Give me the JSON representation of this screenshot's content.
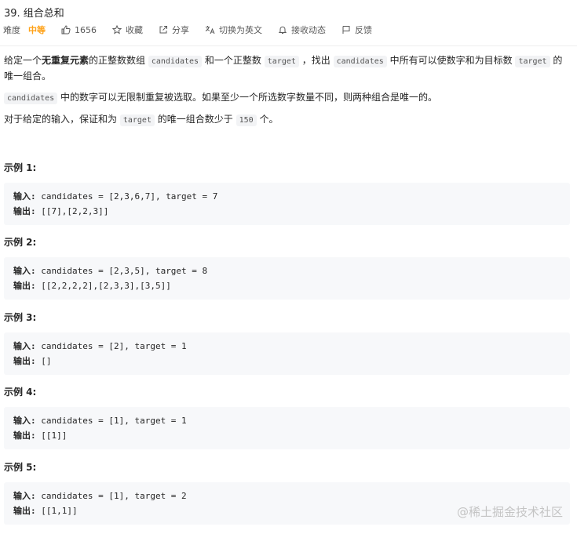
{
  "problem": {
    "title": "39. 组合总和",
    "difficulty_label": "难度",
    "difficulty_value": "中等",
    "likes": "1656",
    "favorite_label": "收藏",
    "share_label": "分享",
    "switch_lang_label": "切换为英文",
    "subscribe_label": "接收动态",
    "feedback_label": "反馈"
  },
  "description": {
    "p1_a": "给定一个",
    "p1_b": "无重复元素",
    "p1_c": "的正整数数组",
    "p1_code1": "candidates",
    "p1_d": "和一个正整数",
    "p1_code2": "target",
    "p1_e": "，找出",
    "p1_code3": "candidates",
    "p1_f": "中所有可以使数字和为目标数",
    "p1_code4": "target",
    "p1_g": "的唯一组合。",
    "p2_code": "candidates",
    "p2_text": "中的数字可以无限制重复被选取。如果至少一个所选数字数量不同，则两种组合是唯一的。",
    "p3_a": "对于给定的输入，保证和为",
    "p3_code1": "target",
    "p3_b": "的唯一组合数少于",
    "p3_code2": "150",
    "p3_c": "个。"
  },
  "examples": [
    {
      "title": "示例 1:",
      "input_label": "输入:",
      "input": " candidates = [2,3,6,7], target = 7",
      "output_label": "输出:",
      "output": " [[7],[2,2,3]]"
    },
    {
      "title": "示例 2:",
      "input_label": "输入:",
      "input": " candidates = [2,3,5], target = 8",
      "output_label": "输出:",
      "output": " [[2,2,2,2],[2,3,3],[3,5]]"
    },
    {
      "title": "示例 3:",
      "input_label": "输入:",
      "input": " candidates = [2], target = 1",
      "output_label": "输出:",
      "output": " []"
    },
    {
      "title": "示例 4:",
      "input_label": "输入:",
      "input": " candidates = [1], target = 1",
      "output_label": "输出:",
      "output": " [[1]]"
    },
    {
      "title": "示例 5:",
      "input_label": "输入:",
      "input": " candidates = [1], target = 2",
      "output_label": "输出:",
      "output": " [[1,1]]"
    }
  ],
  "watermark": "@稀土掘金技术社区",
  "icons": {
    "like": "thumbs-up-icon",
    "favorite": "star-icon",
    "share": "share-icon",
    "translate": "translate-icon",
    "subscribe": "bell-icon",
    "feedback": "flag-icon"
  },
  "colors": {
    "accent": "#ffa116",
    "code_bg": "#f2f3f5",
    "example_bg": "#f7f8fa"
  }
}
